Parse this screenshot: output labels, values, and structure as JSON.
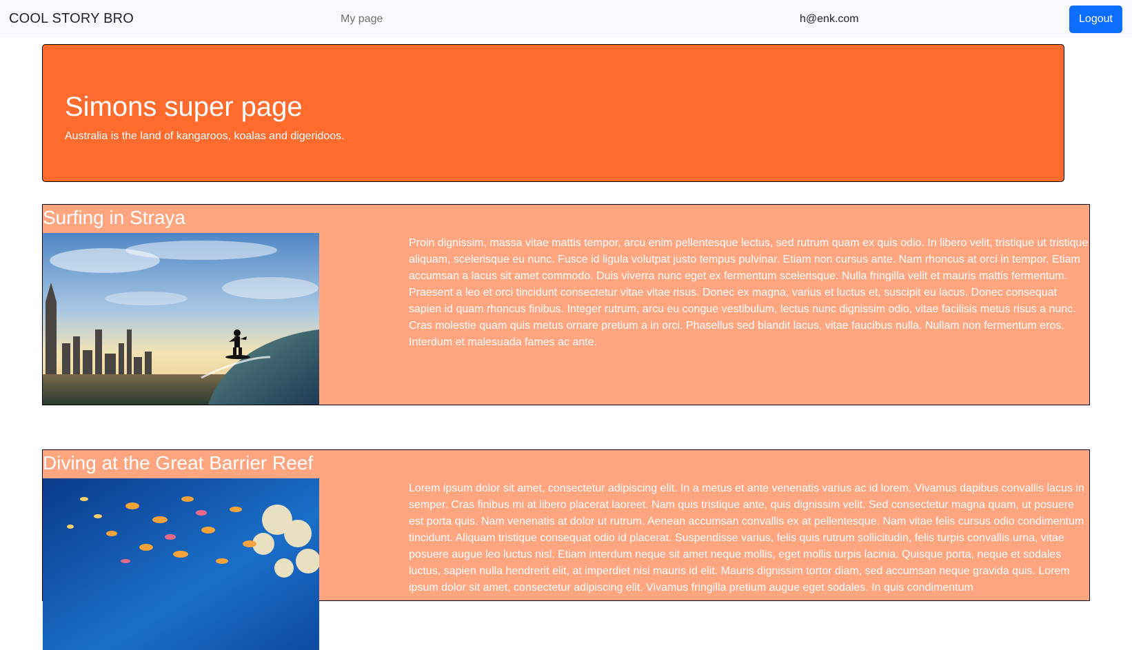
{
  "navbar": {
    "brand": "COOL STORY BRO",
    "my_page_link": "My page",
    "user_email": "h@enk.com",
    "logout_label": "Logout"
  },
  "hero": {
    "title": "Simons super page",
    "subtitle": "Australia is the land of kangaroos, koalas and digeridoos.",
    "background_color": "#ff6b2d"
  },
  "stories": [
    {
      "title": "Surfing in Straya",
      "image_icon": "surfer-photo",
      "text": "Proin dignissim, massa vitae mattis tempor, arcu enim pellentesque lectus, sed rutrum quam ex quis odio. In libero velit, tristique ut tristique aliquam, scelerisque eu nunc. Fusce id ligula volutpat justo tempus pulvinar. Etiam non cursus ante. Nam rhoncus at orci in tempor. Etiam accumsan a lacus sit amet commodo. Duis viverra nunc eget ex fermentum scelerisque. Nulla fringilla velit et mauris mattis fermentum. Praesent a leo et orci tincidunt consectetur vitae vitae risus. Donec ex magna, varius et luctus et, suscipit eu lacus. Donec consequat sapien id quam rhoncus finibus. Integer rutrum, arcu eu congue vestibulum, lectus nunc dignissim odio, vitae facilisis metus risus a nunc. Cras molestie quam quis metus ornare pretium a in orci. Phasellus sed blandit lacus, vitae faucibus nulla. Nullam non fermentum eros. Interdum et malesuada fames ac ante."
    },
    {
      "title": "Diving at the Great Barrier Reef",
      "image_icon": "coral-reef-photo",
      "text": "Lorem ipsum dolor sit amet, consectetur adipiscing elit. In a metus et ante venenatis varius ac id lorem. Vivamus dapibus convallis lacus in semper. Cras finibus mi at libero placerat laoreet. Nam quis tristique ante, quis dignissim velit. Sed consectetur magna quam, ut posuere est porta quis. Nam venenatis at dolor ut rutrum. Aenean accumsan convallis ex at pellentesque. Nam vitae felis cursus odio condimentum tincidunt. Aliquam tristique consequat odio id placerat. Suspendisse varius, felis quis rutrum sollicitudin, felis turpis convallis urna, vitae posuere augue leo luctus nisl. Etiam interdum neque sit amet neque mollis, eget mollis turpis lacinia. Quisque porta, neque et sodales luctus, sapien nulla hendrerit elit, at imperdiet nisi mauris id elit. Mauris dignissim tortor diam, sed accumsan neque gravida quis. Lorem ipsum dolor sit amet, consectetur adipiscing elit. Vivamus fringilla pretium augue eget sodales. In quis condimentum"
    }
  ],
  "colors": {
    "navbar_bg": "#f8f9fa",
    "logout_bg": "#0d6efd",
    "story_bg": "#ffa580"
  }
}
